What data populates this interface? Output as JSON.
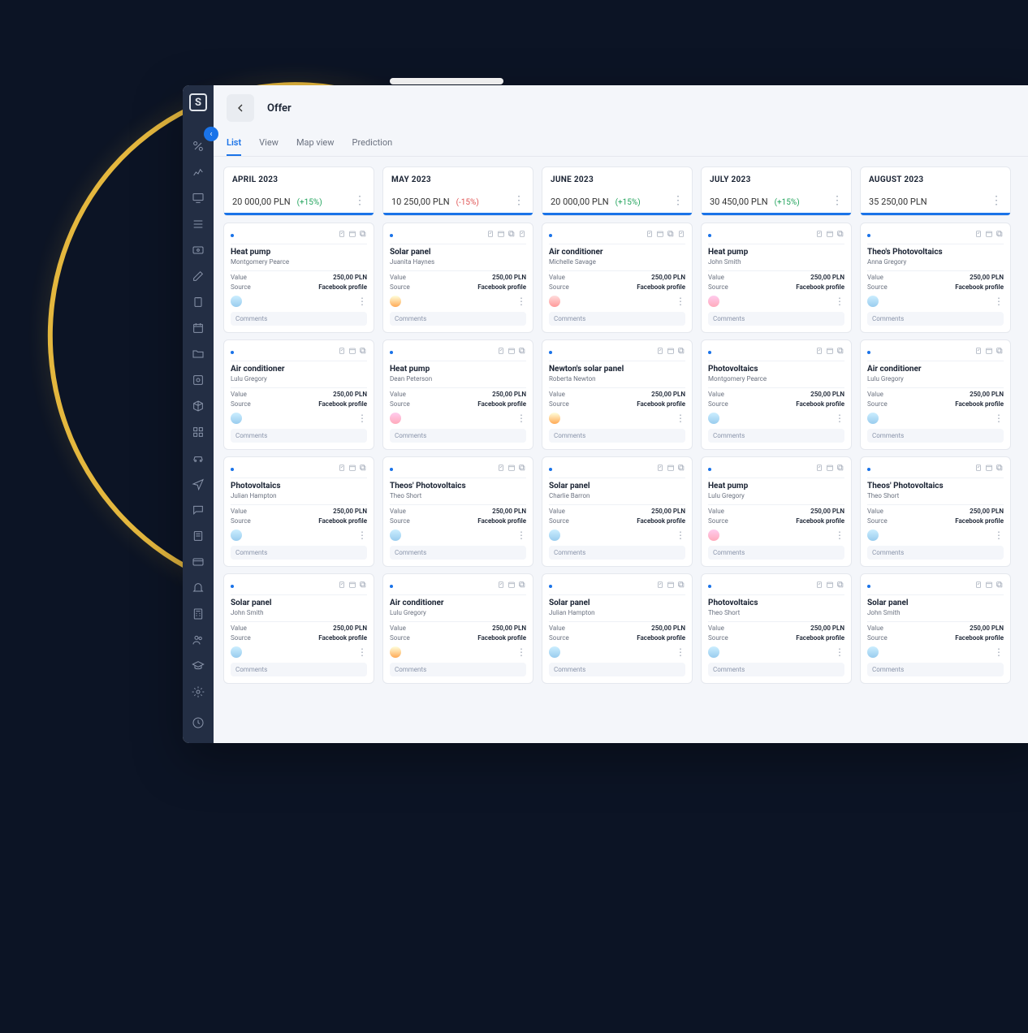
{
  "header": {
    "title": "Offer"
  },
  "tabs": [
    "List",
    "View",
    "Map view",
    "Prediction"
  ],
  "activeTab": 0,
  "sidebar": {
    "icons": [
      "percent-icon",
      "chart-icon",
      "monitor-icon",
      "list-icon",
      "money-icon",
      "edit-icon",
      "clipboard-icon",
      "calendar-icon",
      "folder-icon",
      "gear-box-icon",
      "cube-icon",
      "grid-icon",
      "car-icon",
      "send-icon",
      "chat-icon",
      "note-icon",
      "card-icon",
      "bell-icon",
      "calc-icon",
      "users-icon",
      "graduation-icon",
      "settings-icon"
    ],
    "bottom_icon": "clock-icon"
  },
  "labels": {
    "value": "Value",
    "source": "Source",
    "comments": "Comments"
  },
  "defaults": {
    "price": "250,00 PLN",
    "source": "Facebook profile"
  },
  "columns": [
    {
      "month": "APRIL 2023",
      "amount": "20 000,00 PLN",
      "delta": "(+15%)",
      "delta_sign": "pos",
      "cards": [
        {
          "title": "Heat pump",
          "person": "Montgomery Pearce",
          "avatar": 2,
          "icons": 3
        },
        {
          "title": "Air conditioner",
          "person": "Lulu Gregory",
          "avatar": 2,
          "icons": 3
        },
        {
          "title": "Photovoltaics",
          "person": "Julian Hampton",
          "avatar": 2,
          "icons": 3
        },
        {
          "title": "Solar panel",
          "person": "John Smith",
          "avatar": 2,
          "icons": 3
        }
      ]
    },
    {
      "month": "MAY 2023",
      "amount": "10 250,00 PLN",
      "delta": "(-15%)",
      "delta_sign": "neg",
      "cards": [
        {
          "title": "Solar panel",
          "person": "Juanita Haynes",
          "avatar": 1,
          "icons": 4
        },
        {
          "title": "Heat pump",
          "person": "Dean Peterson",
          "avatar": 0,
          "icons": 3
        },
        {
          "title": "Theos' Photovoltaics",
          "person": "Theo Short",
          "avatar": 2,
          "icons": 3
        },
        {
          "title": "Air conditioner",
          "person": "Lulu Gregory",
          "avatar": 1,
          "icons": 3
        }
      ]
    },
    {
      "month": "JUNE 2023",
      "amount": "20 000,00 PLN",
      "delta": "(+15%)",
      "delta_sign": "pos",
      "cards": [
        {
          "title": "Air conditioner",
          "person": "Michelle Savage",
          "avatar": 3,
          "icons": 4
        },
        {
          "title": "Newton's solar panel",
          "person": "Roberta Newton",
          "avatar": 1,
          "icons": 3
        },
        {
          "title": "Solar panel",
          "person": "Charlie Barron",
          "avatar": 2,
          "icons": 3
        },
        {
          "title": "Solar panel",
          "person": "Julian Hampton",
          "avatar": 2,
          "icons": 3
        }
      ]
    },
    {
      "month": "JULY 2023",
      "amount": "30 450,00 PLN",
      "delta": "(+15%)",
      "delta_sign": "pos",
      "cards": [
        {
          "title": "Heat pump",
          "person": "John Smith",
          "avatar": 0,
          "icons": 3
        },
        {
          "title": "Photovoltaics",
          "person": "Montgomery Pearce",
          "avatar": 2,
          "icons": 3
        },
        {
          "title": "Heat pump",
          "person": "Lulu Gregory",
          "avatar": 0,
          "icons": 3
        },
        {
          "title": "Photovoltaics",
          "person": "Theo Short",
          "avatar": 2,
          "icons": 3
        }
      ]
    },
    {
      "month": "AUGUST 2023",
      "amount": "35 250,00 PLN",
      "delta": "",
      "delta_sign": "pos",
      "cards": [
        {
          "title": "Theo's Photovoltaics",
          "person": "Anna Gregory",
          "avatar": 2,
          "icons": 3
        },
        {
          "title": "Air conditioner",
          "person": "Lulu Gregory",
          "avatar": 2,
          "icons": 3
        },
        {
          "title": "Theos' Photovoltaics",
          "person": "Theo Short",
          "avatar": 2,
          "icons": 3
        },
        {
          "title": "Solar panel",
          "person": "John Smith",
          "avatar": 2,
          "icons": 3
        }
      ]
    }
  ]
}
